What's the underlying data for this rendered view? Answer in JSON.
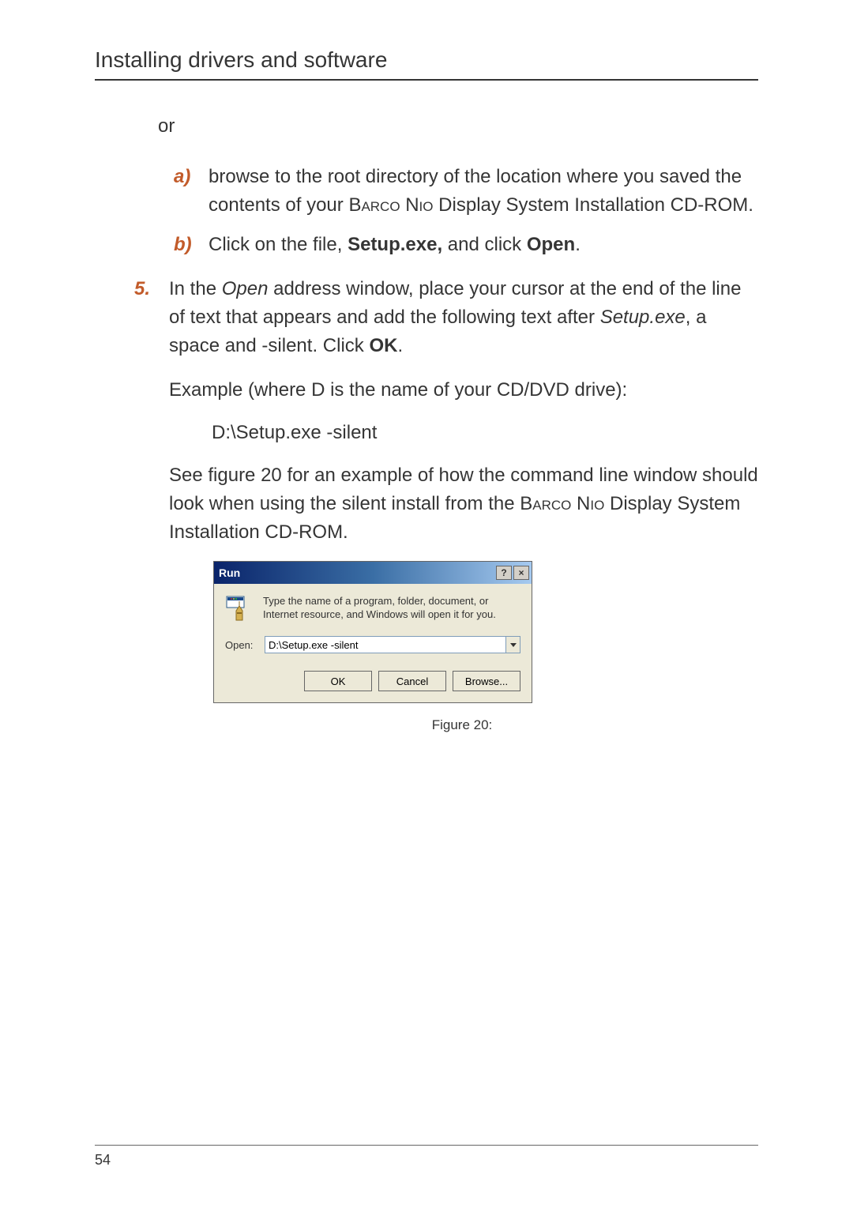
{
  "header": {
    "title": "Installing drivers and software"
  },
  "orText": "or",
  "subList": {
    "a": {
      "marker": "a)",
      "text_pre": "browse to the root directory of the location where you saved the contents of your ",
      "text_sc": "Barco Nio",
      "text_post": " Display System Installation CD-ROM."
    },
    "b": {
      "marker": "b)",
      "text_pre": "Click on the file, ",
      "text_bold1": "Setup.exe,",
      "text_mid": " and click ",
      "text_bold2": "Open",
      "text_post": "."
    }
  },
  "numList": {
    "five": {
      "marker": "5.",
      "text_pre": "In the ",
      "text_it1": "Open",
      "text_mid1": " address window, place your cursor at the end of the line of text that appears and add the following text after ",
      "text_it2": "Setup.exe",
      "text_mid2": ", a space and -silent. Click ",
      "text_bold": "OK",
      "text_post": "."
    }
  },
  "example": {
    "intro": "Example (where D is the name of your CD/DVD drive):",
    "command": "D:\\Setup.exe -silent"
  },
  "seeFigure": {
    "pre": "See figure 20 for an example of how the command line window should look when using the silent install from the ",
    "sc": "Barco Nio",
    "post": " Display System Installation CD-ROM."
  },
  "dialog": {
    "title": "Run",
    "help": "?",
    "close": "×",
    "info": "Type the name of a program, folder, document, or Internet resource, and Windows will open it for you.",
    "openLabel": "Open:",
    "openValue": "D:\\Setup.exe -silent",
    "ok": "OK",
    "cancel": "Cancel",
    "browse": "Browse..."
  },
  "figureCaption": "Figure 20:",
  "pageNumber": "54"
}
